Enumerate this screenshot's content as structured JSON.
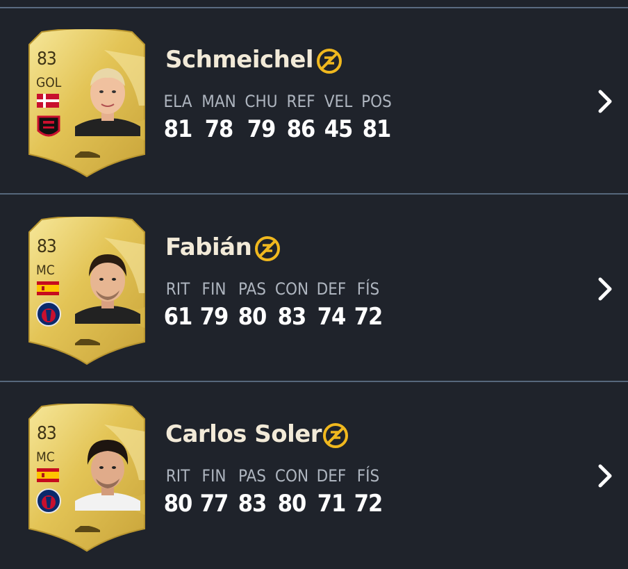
{
  "players": [
    {
      "name": "Schmeichel",
      "rating": "83",
      "position": "GOL",
      "nation_flag_icon": "denmark-flag-icon",
      "club_icon": "ogc-nice-crest-icon",
      "stats": [
        {
          "label": "ELA",
          "value": "81"
        },
        {
          "label": "MAN",
          "value": "78"
        },
        {
          "label": "CHU",
          "value": "79"
        },
        {
          "label": "REF",
          "value": "86"
        },
        {
          "label": "VEL",
          "value": "45"
        },
        {
          "label": "POS",
          "value": "81"
        }
      ]
    },
    {
      "name": "Fabián",
      "rating": "83",
      "position": "MC",
      "nation_flag_icon": "spain-flag-icon",
      "club_icon": "psg-crest-icon",
      "stats": [
        {
          "label": "RIT",
          "value": "61"
        },
        {
          "label": "FIN",
          "value": "79"
        },
        {
          "label": "PAS",
          "value": "80"
        },
        {
          "label": "CON",
          "value": "83"
        },
        {
          "label": "DEF",
          "value": "74"
        },
        {
          "label": "FÍS",
          "value": "72"
        }
      ]
    },
    {
      "name": "Carlos Soler",
      "rating": "83",
      "position": "MC",
      "nation_flag_icon": "spain-flag-icon",
      "club_icon": "psg-crest-icon",
      "stats": [
        {
          "label": "RIT",
          "value": "80"
        },
        {
          "label": "FIN",
          "value": "77"
        },
        {
          "label": "PAS",
          "value": "83"
        },
        {
          "label": "CON",
          "value": "80"
        },
        {
          "label": "DEF",
          "value": "71"
        },
        {
          "label": "FÍS",
          "value": "72"
        }
      ]
    }
  ],
  "colors": {
    "background": "#1f232b",
    "divider": "#56677c",
    "card_gold": "#e8cf5e",
    "chemistry_badge": "#f0b81e",
    "name_text": "#f2ead8",
    "stat_label": "#aeb5bf",
    "stat_value": "#ffffff"
  },
  "icons": {
    "chemistry": "chemistry-style-icon",
    "chevron": "chevron-right-icon",
    "boot": "boot-icon"
  }
}
